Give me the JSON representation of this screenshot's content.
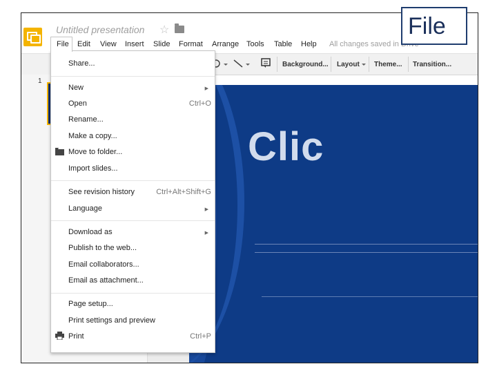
{
  "callout": {
    "label": "File"
  },
  "header": {
    "title": "Untitled presentation",
    "star": "☆",
    "menu": [
      "File",
      "Edit",
      "View",
      "Insert",
      "Slide",
      "Format",
      "Arrange",
      "Tools",
      "Table",
      "Help"
    ],
    "save_status": "All changes saved in Drive"
  },
  "toolbar": {
    "background": "Background...",
    "layout": "Layout",
    "theme": "Theme...",
    "transition": "Transition..."
  },
  "filmstrip": {
    "slide_number": "1"
  },
  "slide": {
    "title": "Clic"
  },
  "file_menu": {
    "share": "Share...",
    "new": "New",
    "open": "Open",
    "open_shortcut": "Ctrl+O",
    "rename": "Rename...",
    "make_copy": "Make a copy...",
    "move_to_folder": "Move to folder...",
    "import_slides": "Import slides...",
    "revision_history": "See revision history",
    "revision_shortcut": "Ctrl+Alt+Shift+G",
    "language": "Language",
    "download_as": "Download as",
    "publish": "Publish to the web...",
    "email_collaborators": "Email collaborators...",
    "email_attachment": "Email as attachment...",
    "page_setup": "Page setup...",
    "print_settings": "Print settings and preview",
    "print": "Print",
    "print_shortcut": "Ctrl+P"
  },
  "colors": {
    "accent": "#f4b400",
    "slide_bg": "#0e3b86",
    "callout_border": "#1e3c6e"
  }
}
